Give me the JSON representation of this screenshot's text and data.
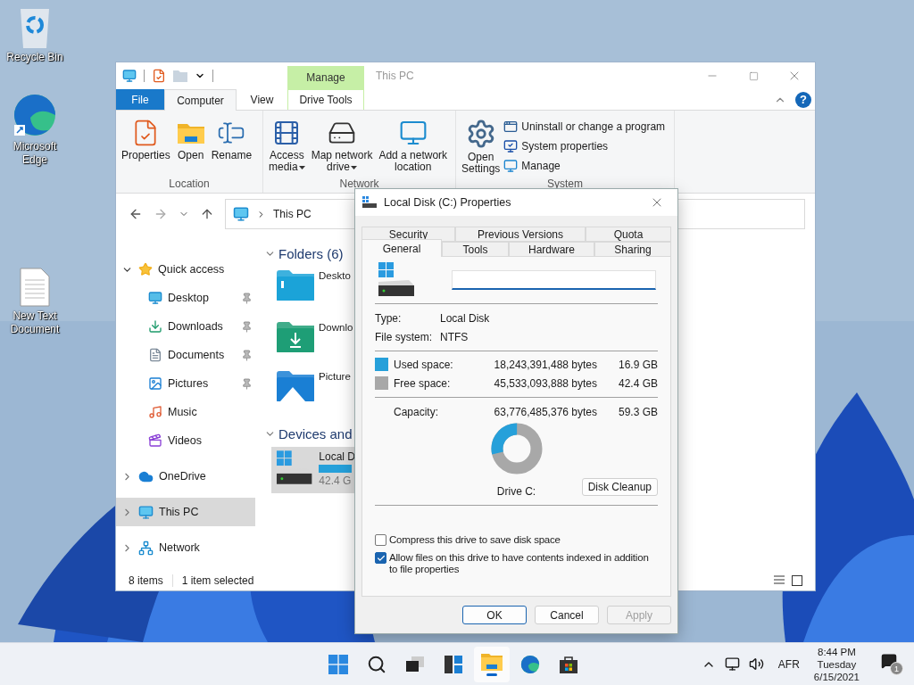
{
  "desktop_icons": [
    {
      "label": "Recycle Bin"
    },
    {
      "label": "Microsoft Edge"
    },
    {
      "label": "New Text Document"
    }
  ],
  "explorer": {
    "title": "This PC",
    "context_group": "Manage",
    "tabs": [
      {
        "label": "File",
        "kind": "file",
        "selected": false
      },
      {
        "label": "Computer",
        "kind": "normal",
        "selected": true
      },
      {
        "label": "View",
        "kind": "normal",
        "selected": false
      },
      {
        "label": "Drive Tools",
        "kind": "context",
        "selected": false
      }
    ],
    "help": "?",
    "ribbon_groups": [
      {
        "label": "Location",
        "buttons": [
          {
            "lines": [
              "Properties"
            ],
            "has_menu": false
          },
          {
            "lines": [
              "Open"
            ],
            "has_menu": false
          },
          {
            "lines": [
              "Rename"
            ],
            "has_menu": false
          }
        ]
      },
      {
        "label": "Network",
        "buttons": [
          {
            "lines": [
              "Access",
              "media"
            ],
            "has_menu": true
          },
          {
            "lines": [
              "Map network",
              "drive"
            ],
            "has_menu": true
          },
          {
            "lines": [
              "Add a network",
              "location"
            ],
            "has_menu": false
          }
        ]
      },
      {
        "label": "System",
        "buttons": [
          {
            "lines": [
              "Open",
              "Settings"
            ],
            "has_menu": false
          }
        ],
        "small_buttons": [
          {
            "label": "Uninstall or change a program"
          },
          {
            "label": "System properties"
          },
          {
            "label": "Manage"
          }
        ]
      }
    ],
    "address": "This PC",
    "nav": [
      {
        "label": "Quick access",
        "expanded": true,
        "selected": false,
        "children": [
          {
            "label": "Desktop",
            "pinned": true
          },
          {
            "label": "Downloads",
            "pinned": true
          },
          {
            "label": "Documents",
            "pinned": true
          },
          {
            "label": "Pictures",
            "pinned": true
          },
          {
            "label": "Music",
            "pinned": false
          },
          {
            "label": "Videos",
            "pinned": false
          }
        ]
      },
      {
        "label": "OneDrive",
        "expanded": false,
        "selected": false
      },
      {
        "label": "This PC",
        "expanded": false,
        "selected": true
      },
      {
        "label": "Network",
        "expanded": false,
        "selected": false
      }
    ],
    "sections": [
      {
        "title": "Folders (6)",
        "items": [
          {
            "label": "Deskto",
            "selected": false
          },
          {
            "label": "Downlo",
            "selected": false
          },
          {
            "label": "Picture",
            "selected": false
          }
        ]
      },
      {
        "title": "Devices and",
        "items": [
          {
            "label": "Local D",
            "detail": "42.4 G",
            "selected": true
          }
        ]
      }
    ],
    "status": {
      "count": "8 items",
      "selection": "1 item selected"
    }
  },
  "dialog": {
    "title": "Local Disk (C:) Properties",
    "tab_rows": [
      [
        {
          "label": "Security",
          "selected": false
        },
        {
          "label": "Previous Versions",
          "selected": false
        },
        {
          "label": "Quota",
          "selected": false
        }
      ],
      [
        {
          "label": "General",
          "selected": true
        },
        {
          "label": "Tools",
          "selected": false
        },
        {
          "label": "Hardware",
          "selected": false
        },
        {
          "label": "Sharing",
          "selected": false
        }
      ]
    ],
    "info": [
      {
        "label": "Type:",
        "value": "Local Disk"
      },
      {
        "label": "File system:",
        "value": "NTFS"
      }
    ],
    "space": [
      {
        "label": "Used space:",
        "bytes": "18,243,391,488 bytes",
        "size": "16.9 GB",
        "color": "#26a0da"
      },
      {
        "label": "Free space:",
        "bytes": "45,533,093,888 bytes",
        "size": "42.4 GB",
        "color": "#a8a8a8"
      }
    ],
    "capacity": {
      "label": "Capacity:",
      "bytes": "63,776,485,376 bytes",
      "size": "59.3 GB"
    },
    "drive_label": "Drive C:",
    "cleanup": "Disk Cleanup",
    "options": [
      {
        "label": "Compress this drive to save disk space",
        "checked": false
      },
      {
        "label": "Allow files on this drive to have contents indexed in addition to file properties",
        "checked": true
      }
    ],
    "buttons": [
      {
        "label": "OK",
        "default": true,
        "disabled": false
      },
      {
        "label": "Cancel",
        "default": false,
        "disabled": false
      },
      {
        "label": "Apply",
        "default": false,
        "disabled": true
      }
    ]
  },
  "taskbar": {
    "apps": [
      {
        "active": false
      },
      {
        "active": false
      },
      {
        "active": false
      },
      {
        "active": false
      },
      {
        "active": true
      },
      {
        "active": false
      },
      {
        "active": false
      }
    ],
    "language": "AFR",
    "time": "8:44 PM",
    "day": "Tuesday",
    "date": "6/15/2021",
    "notifications": "1"
  }
}
